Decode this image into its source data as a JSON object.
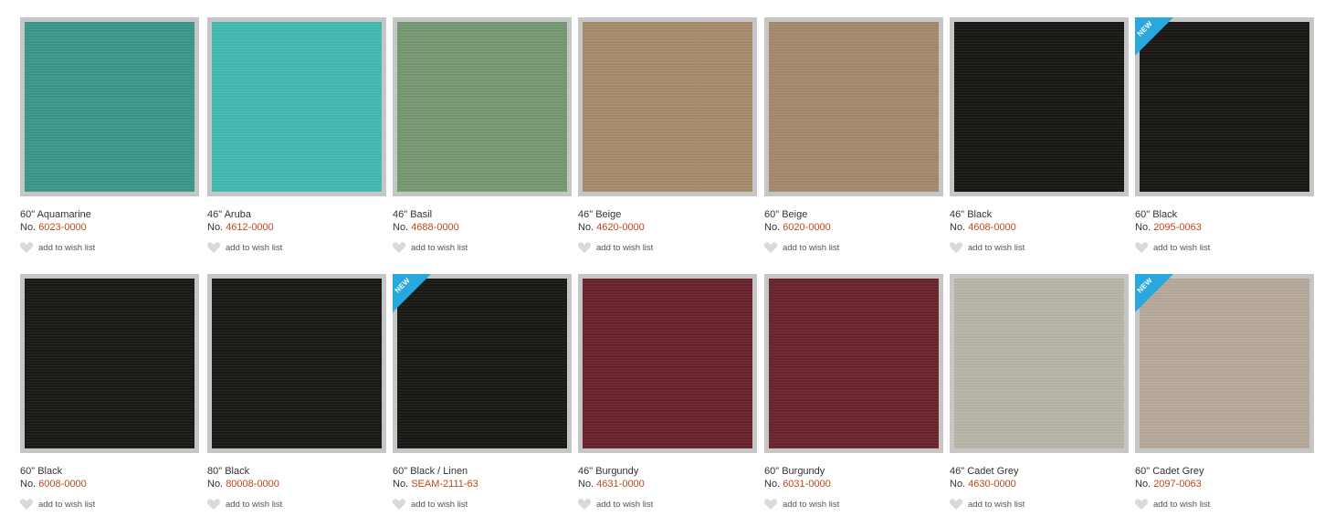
{
  "products": [
    {
      "name": "60\" Aquamarine",
      "no_label": "No.",
      "number": "6023-0000",
      "color": "#3c9a8a",
      "is_new": false,
      "wish": "add to wish list"
    },
    {
      "name": "46\" Aruba",
      "no_label": "No.",
      "number": "4612-0000",
      "color": "#45bcb4",
      "is_new": false,
      "wish": "add to wish list"
    },
    {
      "name": "46\" Basil",
      "no_label": "No.",
      "number": "4688-0000",
      "color": "#779b75",
      "is_new": false,
      "wish": "add to wish list"
    },
    {
      "name": "46\" Beige",
      "no_label": "No.",
      "number": "4620-0000",
      "color": "#a88d6c",
      "is_new": false,
      "wish": "add to wish list"
    },
    {
      "name": "60\" Beige",
      "no_label": "No.",
      "number": "6020-0000",
      "color": "#a68b6c",
      "is_new": false,
      "wish": "add to wish list"
    },
    {
      "name": "46\" Black",
      "no_label": "No.",
      "number": "4608-0000",
      "color": "#1a1814",
      "is_new": false,
      "wish": "add to wish list"
    },
    {
      "name": "60\" Black",
      "no_label": "No.",
      "number": "2095-0063",
      "color": "#1b1915",
      "is_new": true,
      "wish": "add to wish list"
    },
    {
      "name": "60\" Black",
      "no_label": "No.",
      "number": "6008-0000",
      "color": "#1c1a16",
      "is_new": false,
      "wish": "add to wish list"
    },
    {
      "name": "80\" Black",
      "no_label": "No.",
      "number": "80008-0000",
      "color": "#1c1a16",
      "is_new": false,
      "wish": "add to wish list"
    },
    {
      "name": "60\" Black / Linen",
      "no_label": "No.",
      "number": "SEAM-2111-63",
      "color": "#1b1915",
      "is_new": true,
      "wish": "add to wish list"
    },
    {
      "name": "46\" Burgundy",
      "no_label": "No.",
      "number": "4631-0000",
      "color": "#6b242d",
      "is_new": false,
      "wish": "add to wish list"
    },
    {
      "name": "60\" Burgundy",
      "no_label": "No.",
      "number": "6031-0000",
      "color": "#6b252e",
      "is_new": false,
      "wish": "add to wish list"
    },
    {
      "name": "46\" Cadet Grey",
      "no_label": "No.",
      "number": "4630-0000",
      "color": "#bab6a8",
      "is_new": false,
      "wish": "add to wish list"
    },
    {
      "name": "60\" Cadet Grey",
      "no_label": "No.",
      "number": "2097-0063",
      "color": "#b9ab9c",
      "is_new": true,
      "wish": "add to wish list"
    }
  ],
  "badge_text": "NEW",
  "colors": {
    "frame": "#c6c6c6",
    "number_link": "#c0481e",
    "badge": "#29a8e0",
    "heart": "#d9d9d9"
  }
}
